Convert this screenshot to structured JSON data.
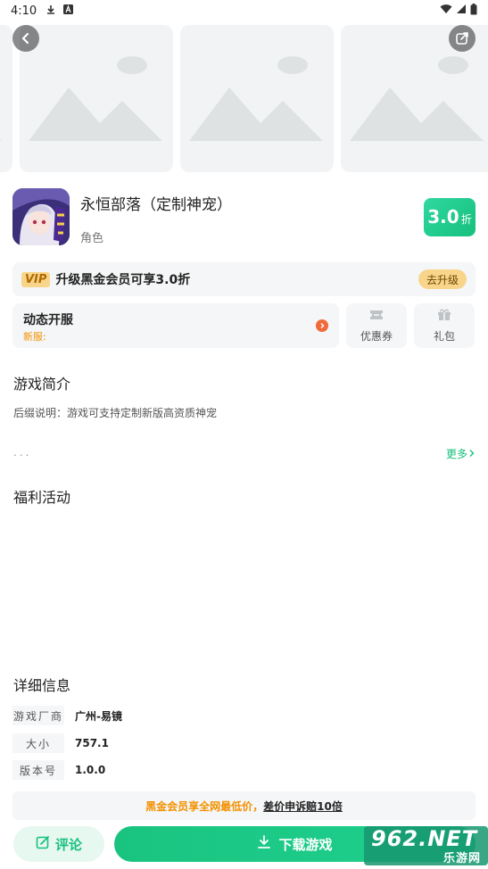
{
  "status_bar": {
    "time": "4:10",
    "icons": [
      "download-icon",
      "a-badge-icon",
      "wifi-icon",
      "signal-icon",
      "battery-icon"
    ]
  },
  "gallery": {
    "screenshot_count": 4,
    "back_icon": "back-arrow-icon",
    "share_icon": "external-share-icon"
  },
  "app": {
    "title": "永恒部落（定制神宠）",
    "category": "角色",
    "discount_value": "3.0",
    "discount_unit": "折",
    "discount_color": "#17c07d"
  },
  "vip": {
    "tag": "VIP",
    "text": "升级黑金会员可享3.0折",
    "upgrade_label": "去升级"
  },
  "service": {
    "title": "动态开服",
    "subtitle": "新服:"
  },
  "quick_actions": [
    {
      "label": "优惠券",
      "icon": "coupon-icon"
    },
    {
      "label": "礼包",
      "icon": "gift-icon"
    }
  ],
  "intro": {
    "title": "游戏简介",
    "text": "后缀说明：游戏可支持定制新版高资质神宠",
    "ellipsis": "...",
    "more_label": "更多"
  },
  "welfare": {
    "title": "福利活动"
  },
  "details": {
    "title": "详细信息",
    "rows": [
      {
        "label": "游戏厂商",
        "value": "广州-易镜"
      },
      {
        "label": "大小",
        "value": "757.1"
      },
      {
        "label": "版本号",
        "value": "1.0.0"
      }
    ]
  },
  "promo": {
    "text_a": "黑金会员享全网最低价，",
    "text_b": "差价申诉赔10倍"
  },
  "bottom": {
    "comment_label": "评论",
    "download_label": "下载游戏"
  },
  "watermark": {
    "main": "962.NET",
    "sub": "乐游网"
  }
}
